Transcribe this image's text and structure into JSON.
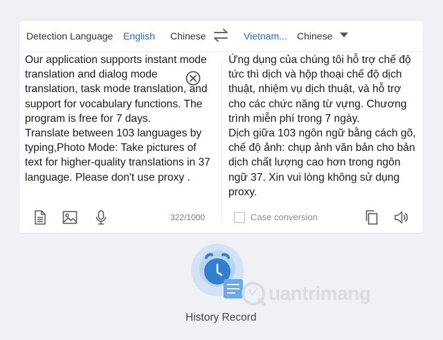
{
  "langbar": {
    "detection": "Detection Language",
    "source_options": [
      "English",
      "Chinese"
    ],
    "target_options": [
      "Vietnam...",
      "Chinese"
    ]
  },
  "source": {
    "text": "Our application supports instant mode translation and dialog mode translation, task mode translation, and support for vocabulary functions. The program is free for 7 days.\nTranslate between 103 languages by typing,Photo Mode: Take pictures of text for higher-quality translations in 37 language. Please don't use proxy .",
    "counter": "322/1000"
  },
  "target": {
    "text": "Ứng dụng của chúng tôi hỗ trợ chế độ tức thì dịch và hộp thoại chế độ dịch thuật, nhiệm vụ dịch thuật, và hỗ trợ cho các chức năng từ vựng. Chương trình miễn phí trong 7 ngày.\nDịch giữa 103 ngôn ngữ bằng cách gõ, chế độ ảnh: chụp ảnh văn bản cho bản dịch chất lượng cao hơn trong ngôn ngữ 37. Xin vui lòng không sử dụng proxy.",
    "case_conversion": "Case conversion"
  },
  "history": {
    "label": "History Record"
  },
  "watermark": {
    "text": "uantrimang"
  },
  "colors": {
    "accent": "#1d6fdc",
    "history_circle": "#cfe0f3",
    "history_clock": "#2f80d1"
  },
  "icons": {
    "swap": "swap-icon",
    "clear": "close-circle-icon",
    "doc": "document-icon",
    "image": "image-icon",
    "mic": "microphone-icon",
    "copy": "copy-icon",
    "speaker": "speaker-icon",
    "dropdown": "caret-down-icon",
    "history": "history-clock-icon"
  }
}
